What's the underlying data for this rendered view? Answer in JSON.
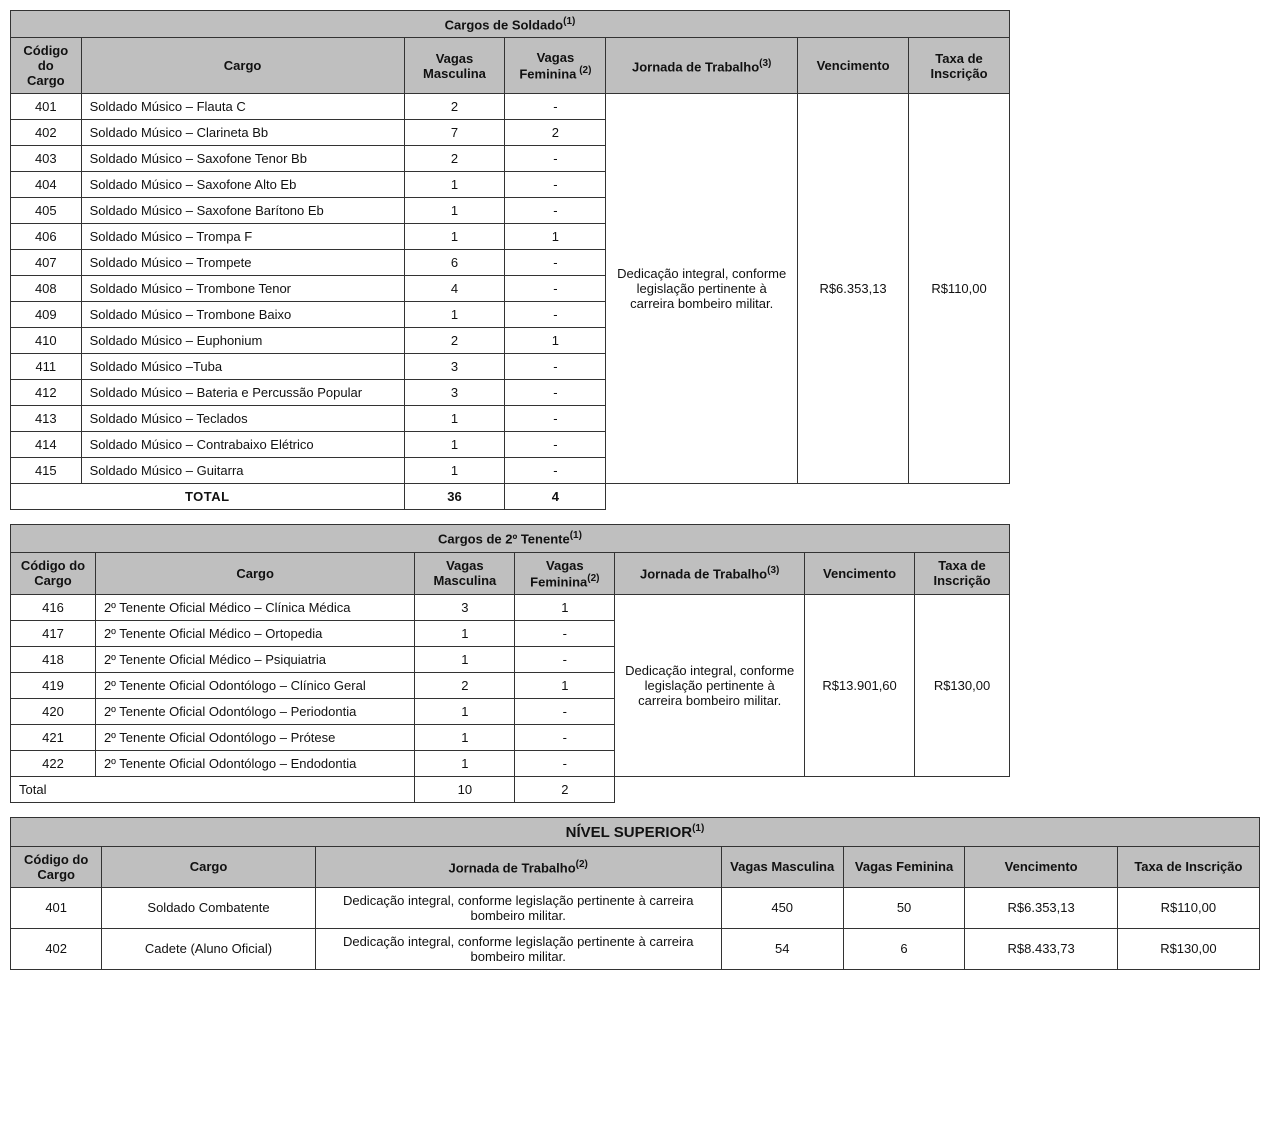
{
  "table1": {
    "title": "Cargos de Soldado",
    "title_sup": "(1)",
    "headers": {
      "codigo": "Código do Cargo",
      "cargo": "Cargo",
      "vm": "Vagas Masculina",
      "vf": "Vagas Feminina",
      "vf_sup": " (2)",
      "jornada": "Jornada de Trabalho",
      "jornada_sup": "(3)",
      "venc": "Vencimento",
      "taxa": "Taxa de Inscrição"
    },
    "jornada_text": "Dedicação integral, conforme legislação pertinente à carreira bombeiro militar.",
    "venc_text": "R$6.353,13",
    "taxa_text": "R$110,00",
    "rows": [
      {
        "cod": "401",
        "cargo": "Soldado Músico – Flauta C",
        "vm": "2",
        "vf": "-"
      },
      {
        "cod": "402",
        "cargo": "Soldado Músico – Clarineta Bb",
        "vm": "7",
        "vf": "2"
      },
      {
        "cod": "403",
        "cargo": "Soldado Músico – Saxofone Tenor Bb",
        "vm": "2",
        "vf": "-"
      },
      {
        "cod": "404",
        "cargo": "Soldado Músico – Saxofone Alto Eb",
        "vm": "1",
        "vf": "-"
      },
      {
        "cod": "405",
        "cargo": "Soldado Músico – Saxofone Barítono Eb",
        "vm": "1",
        "vf": "-"
      },
      {
        "cod": "406",
        "cargo": "Soldado Músico – Trompa F",
        "vm": "1",
        "vf": "1"
      },
      {
        "cod": "407",
        "cargo": "Soldado Músico – Trompete",
        "vm": "6",
        "vf": "-"
      },
      {
        "cod": "408",
        "cargo": "Soldado Músico – Trombone Tenor",
        "vm": "4",
        "vf": "-"
      },
      {
        "cod": "409",
        "cargo": "Soldado Músico – Trombone Baixo",
        "vm": "1",
        "vf": "-"
      },
      {
        "cod": "410",
        "cargo": "Soldado Músico – Euphonium",
        "vm": "2",
        "vf": "1"
      },
      {
        "cod": "411",
        "cargo": "Soldado Músico –Tuba",
        "vm": "3",
        "vf": "-"
      },
      {
        "cod": "412",
        "cargo": "Soldado Músico – Bateria e Percussão Popular",
        "vm": "3",
        "vf": "-"
      },
      {
        "cod": "413",
        "cargo": "Soldado Músico – Teclados",
        "vm": "1",
        "vf": "-"
      },
      {
        "cod": "414",
        "cargo": "Soldado Músico – Contrabaixo Elétrico",
        "vm": "1",
        "vf": "-"
      },
      {
        "cod": "415",
        "cargo": "Soldado Músico – Guitarra",
        "vm": "1",
        "vf": "-"
      }
    ],
    "total_label": "TOTAL",
    "total_vm": "36",
    "total_vf": "4"
  },
  "table2": {
    "title": "Cargos de 2º Tenente",
    "title_sup": "(1)",
    "headers": {
      "codigo": "Código do Cargo",
      "cargo": "Cargo",
      "vm": "Vagas Masculina",
      "vf": "Vagas Feminina",
      "vf_sup": "(2)",
      "jornada": "Jornada de Trabalho",
      "jornada_sup": "(3)",
      "venc": "Vencimento",
      "taxa": "Taxa de Inscrição"
    },
    "jornada_text": "Dedicação integral, conforme legislação pertinente à carreira bombeiro militar.",
    "venc_text": "R$13.901,60",
    "taxa_text": "R$130,00",
    "rows": [
      {
        "cod": "416",
        "cargo": "2º Tenente Oficial Médico – Clínica Médica",
        "vm": "3",
        "vf": "1"
      },
      {
        "cod": "417",
        "cargo": "2º Tenente Oficial Médico – Ortopedia",
        "vm": "1",
        "vf": "-"
      },
      {
        "cod": "418",
        "cargo": "2º Tenente Oficial Médico – Psiquiatria",
        "vm": "1",
        "vf": "-"
      },
      {
        "cod": "419",
        "cargo": "2º Tenente Oficial Odontólogo – Clínico Geral",
        "vm": "2",
        "vf": "1"
      },
      {
        "cod": "420",
        "cargo": "2º Tenente Oficial Odontólogo – Periodontia",
        "vm": "1",
        "vf": "-"
      },
      {
        "cod": "421",
        "cargo": "2º Tenente Oficial Odontólogo – Prótese",
        "vm": "1",
        "vf": "-"
      },
      {
        "cod": "422",
        "cargo": "2º Tenente Oficial Odontólogo – Endodontia",
        "vm": "1",
        "vf": "-"
      }
    ],
    "total_label": "Total",
    "total_vm": "10",
    "total_vf": "2"
  },
  "table3": {
    "title": "NÍVEL SUPERIOR",
    "title_sup": "(1)",
    "headers": {
      "codigo": "Código do Cargo",
      "cargo": "Cargo",
      "jornada": "Jornada de Trabalho",
      "jornada_sup": "(2)",
      "vm": "Vagas Masculina",
      "vf": "Vagas Feminina",
      "venc": "Vencimento",
      "taxa": "Taxa de Inscrição"
    },
    "rows": [
      {
        "cod": "401",
        "cargo": "Soldado Combatente",
        "jornada": "Dedicação integral, conforme legislação pertinente à carreira bombeiro militar.",
        "vm": "450",
        "vf": "50",
        "venc": "R$6.353,13",
        "taxa": "R$110,00"
      },
      {
        "cod": "402",
        "cargo": "Cadete (Aluno Oficial)",
        "jornada": "Dedicação integral, conforme legislação pertinente à carreira bombeiro militar.",
        "vm": "54",
        "vf": "6",
        "venc": "R$8.433,73",
        "taxa": "R$130,00"
      }
    ]
  }
}
